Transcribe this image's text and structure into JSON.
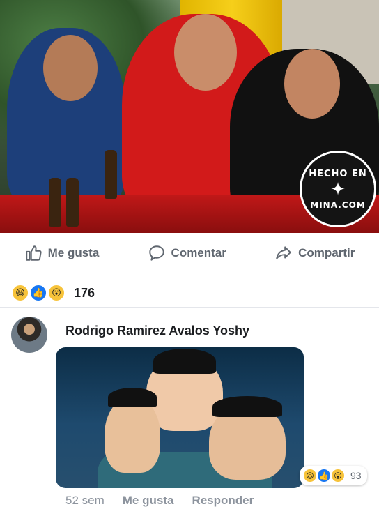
{
  "post": {
    "watermark": {
      "line1": "HECHO EN",
      "line2": "MINA.COM"
    },
    "actions": {
      "like": "Me gusta",
      "comment": "Comentar",
      "share": "Compartir"
    },
    "reactions": {
      "icons": [
        "haha",
        "like",
        "wow"
      ],
      "count": "176"
    }
  },
  "comment": {
    "author": "Rodrigo Ramirez Avalos Yoshy",
    "reactions": {
      "icons": [
        "haha",
        "like",
        "wow"
      ],
      "count": "93"
    },
    "time": "52 sem",
    "like_label": "Me gusta",
    "reply_label": "Responder"
  },
  "colors": {
    "accent": "#1877f2",
    "text_secondary": "#606770"
  }
}
